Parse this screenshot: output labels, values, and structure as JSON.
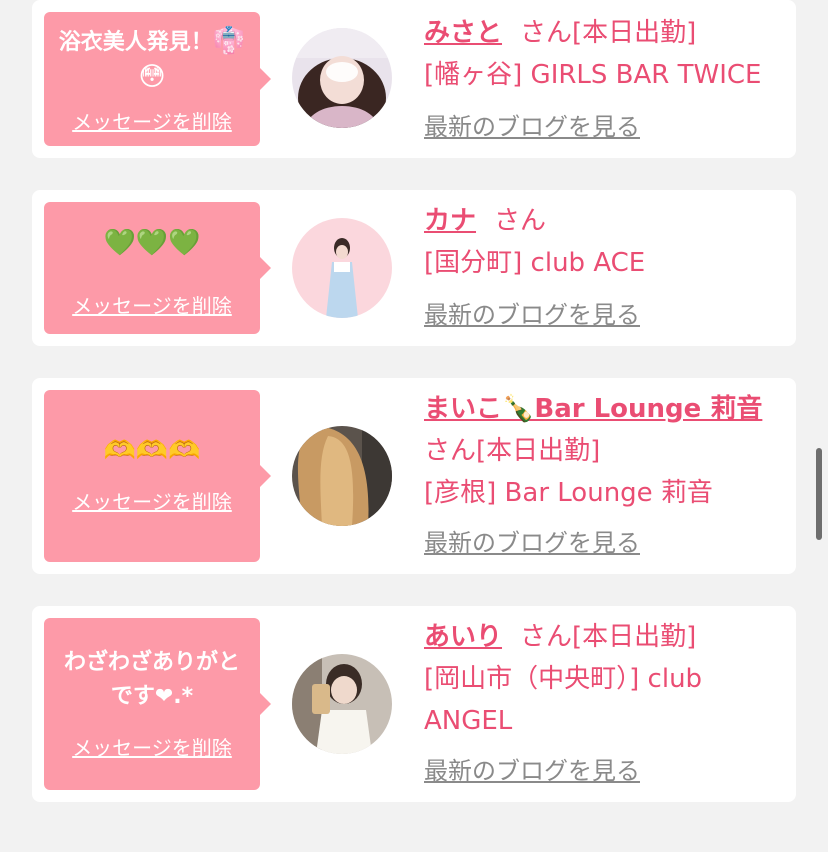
{
  "delete_label": "メッセージを削除",
  "blog_label": "最新のブログを見る",
  "colors": {
    "accent": "#ea4d73",
    "bubble": "#fd9aa8",
    "background": "#f2f2f2"
  },
  "cards": [
    {
      "message": "浴衣美人発見！👘😳",
      "message_line1": "浴衣美人発見！",
      "emoji_a": "👘",
      "emoji_b": "😳",
      "name": "みさと",
      "suffix": "さん[本日出勤]",
      "shop": "[幡ヶ谷] GIRLS BAR TWICE"
    },
    {
      "message": "💚💚💚",
      "name": "カナ",
      "suffix": "さん",
      "shop": "[国分町] club ACE"
    },
    {
      "message": "🫶🫶🫶",
      "name": "まいこ🍾Bar Lounge 莉音",
      "suffix": "さん[本日出勤]",
      "shop": "[彦根] Bar Lounge 莉音"
    },
    {
      "message": "わざわざありがとです❤︎.*",
      "message_line1": "わざわざありがと",
      "message_line2": "です❤︎.*",
      "name": "あいり",
      "suffix": "さん[本日出勤]",
      "shop": "[岡山市（中央町）] club ANGEL"
    }
  ]
}
